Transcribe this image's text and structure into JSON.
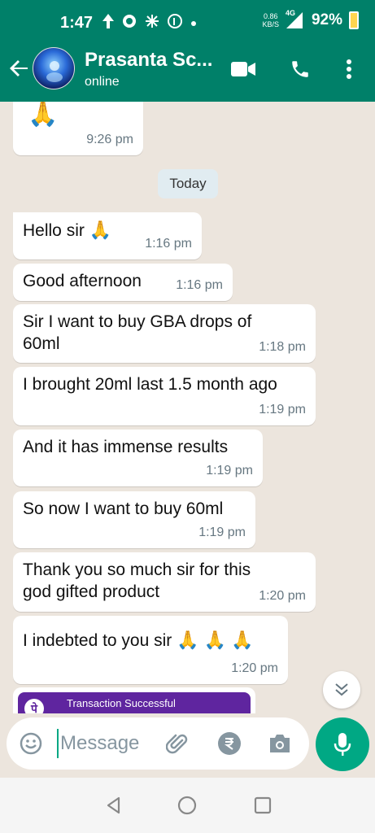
{
  "status_bar": {
    "time": "1:47",
    "net_speed_value": "0.86",
    "net_speed_unit": "KB/S",
    "network": "4G",
    "battery": "92%"
  },
  "header": {
    "contact_name": "Prasanta Sc...",
    "contact_status": "online"
  },
  "chat": {
    "day_label": "Today",
    "messages": [
      {
        "text": "",
        "emoji": "🙏",
        "time": "9:26 pm"
      },
      {
        "text": "Hello sir ",
        "emoji": "🙏",
        "time": "1:16 pm"
      },
      {
        "text": "Good afternoon",
        "time": "1:16 pm"
      },
      {
        "text": "Sir I want to buy GBA drops of 60ml",
        "time": "1:18 pm"
      },
      {
        "text": "I brought 20ml last 1.5 month ago",
        "time": "1:19 pm"
      },
      {
        "text": "And it has immense results",
        "time": "1:19 pm"
      },
      {
        "text": "So now I want to buy 60ml",
        "time": "1:19 pm"
      },
      {
        "text": "Thank you so much sir for this god gifted product",
        "time": "1:20 pm"
      },
      {
        "text": "I indebted to you sir ",
        "emoji": "🙏 🙏 🙏",
        "time": "1:20 pm"
      }
    ],
    "transaction_label": "Transaction Successful"
  },
  "input": {
    "placeholder": "Message"
  },
  "colors": {
    "header_bg": "#008069",
    "accent": "#00a884",
    "chat_bg": "#ece5dd",
    "bubble_bg": "#ffffff",
    "phonepe_purple": "#5f259f"
  }
}
